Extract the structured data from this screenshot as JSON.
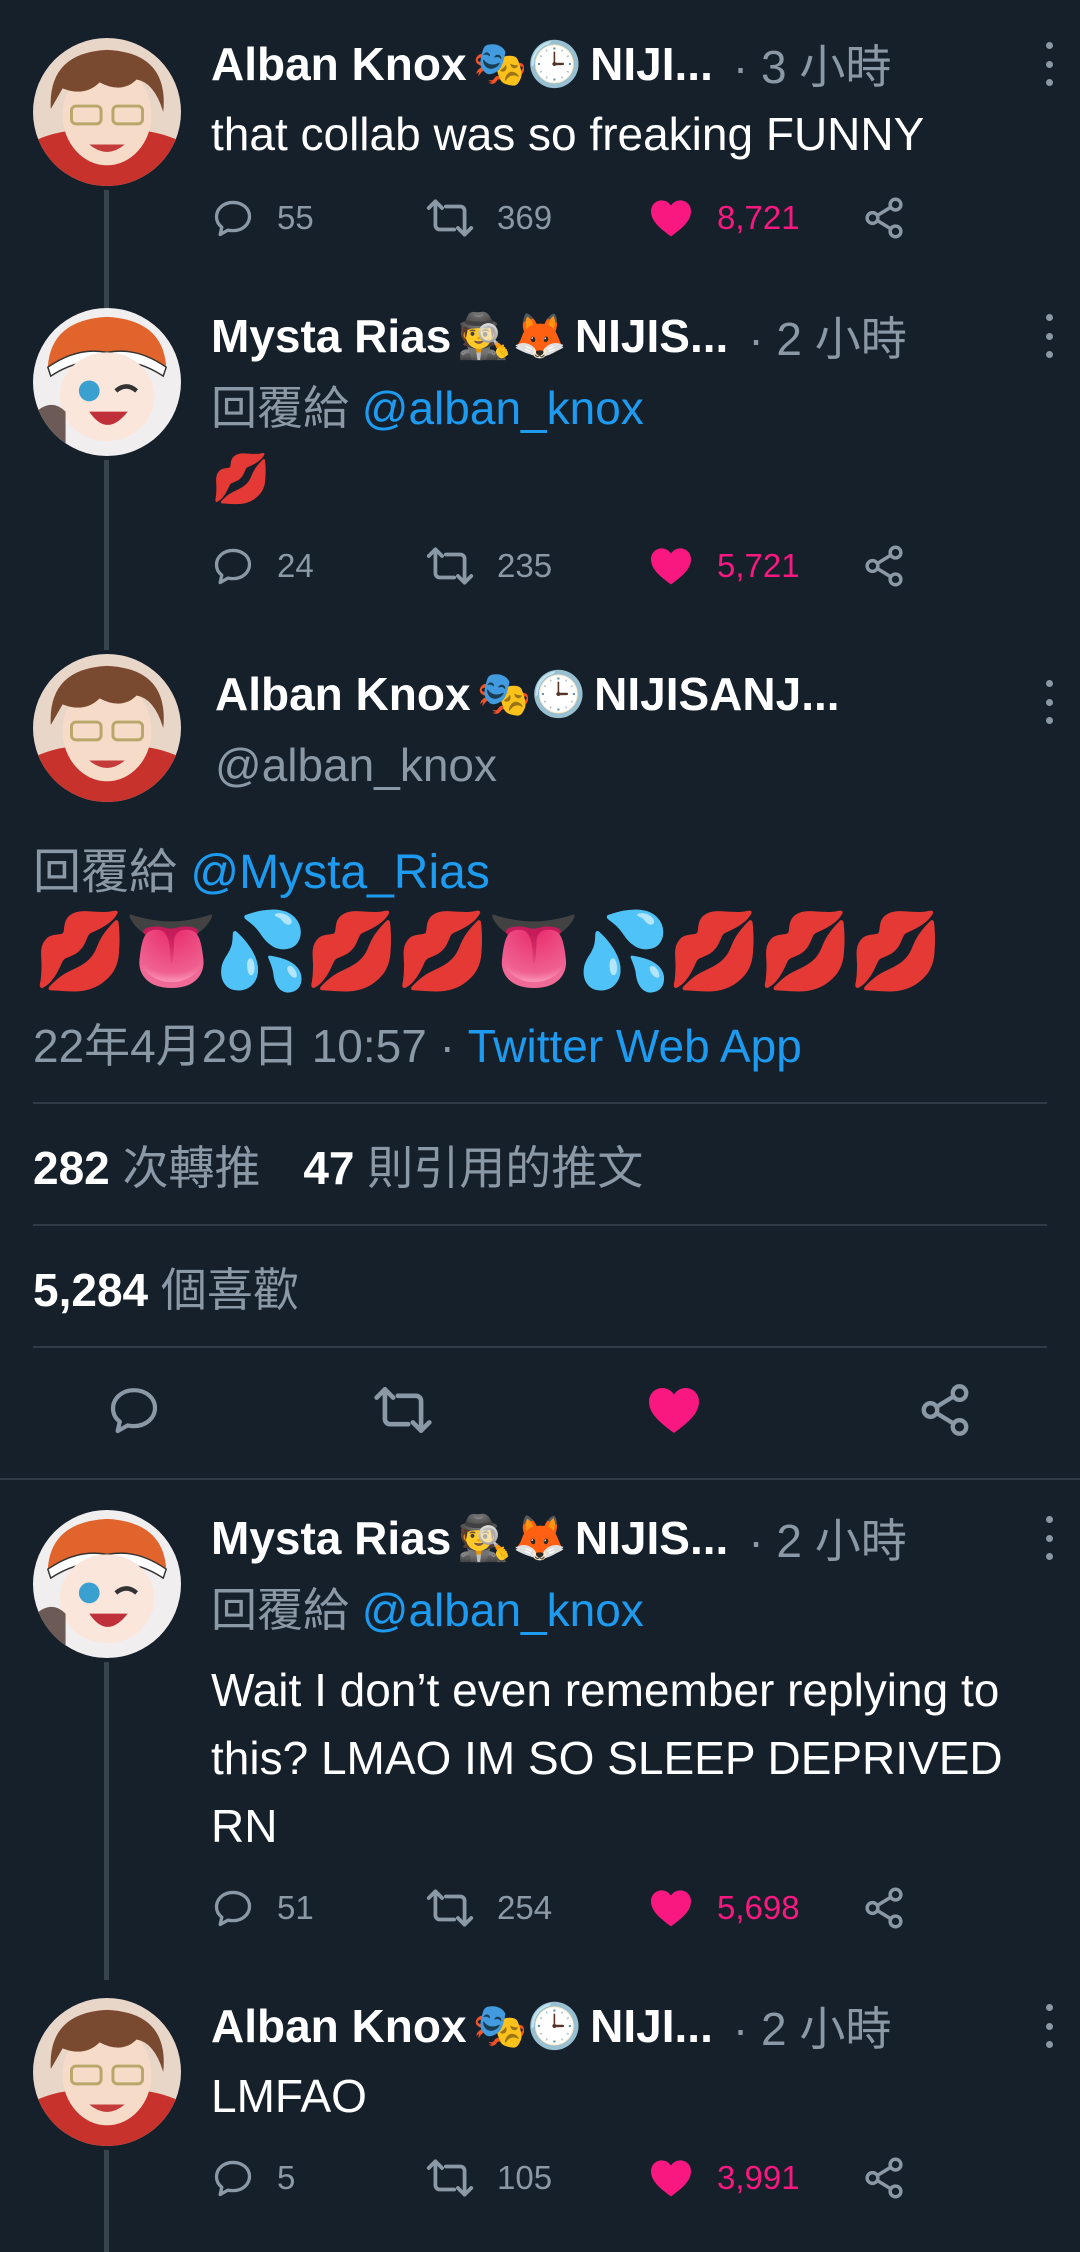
{
  "tweets": [
    {
      "name": "Alban Knox",
      "emoji": "🎭🕒",
      "affiliation": "NIJI...",
      "time": "· 3 小時",
      "text": "that collab was so freaking FUNNY",
      "replies": "55",
      "retweets": "369",
      "likes": "8,721"
    },
    {
      "name": "Mysta Rias",
      "emoji": "🕵🦊",
      "affiliation": "NIJIS...",
      "time": "· 2 小時",
      "reply_prefix": "回覆給",
      "reply_handle": "@alban_knox",
      "text": "💋",
      "replies": "24",
      "retweets": "235",
      "likes": "5,721"
    }
  ],
  "main_tweet": {
    "name": "Alban Knox",
    "emoji": "🎭🕒",
    "affiliation": "NIJISANJ...",
    "handle": "@alban_knox",
    "reply_prefix": "回覆給",
    "reply_handle": "@Mysta_Rias",
    "text": "💋👅💦💋💋👅💦💋💋💋",
    "timestamp": "22年4月29日 10:57 ·",
    "source": "Twitter Web App",
    "retweet_count": "282",
    "retweet_label": "次轉推",
    "quote_count": "47",
    "quote_label": "則引用的推文",
    "like_count": "5,284",
    "like_label": "個喜歡"
  },
  "replies": [
    {
      "name": "Mysta Rias",
      "emoji": "🕵🦊",
      "affiliation": "NIJIS...",
      "time": "· 2 小時",
      "reply_prefix": "回覆給",
      "reply_handle": "@alban_knox",
      "text": "Wait I don’t even remember replying to this? LMAO IM SO SLEEP DEPRIVED RN",
      "replies": "51",
      "retweets": "254",
      "likes": "5,698"
    },
    {
      "name": "Alban Knox",
      "emoji": "🎭🕒",
      "affiliation": "NIJI...",
      "time": "· 2 小時",
      "text": "LMFAO",
      "replies": "5",
      "retweets": "105",
      "likes": "3,991"
    }
  ],
  "colors": {
    "background": "#15202b",
    "like": "#f91880",
    "link": "#1d9bf0",
    "secondary": "#8b98a5"
  }
}
